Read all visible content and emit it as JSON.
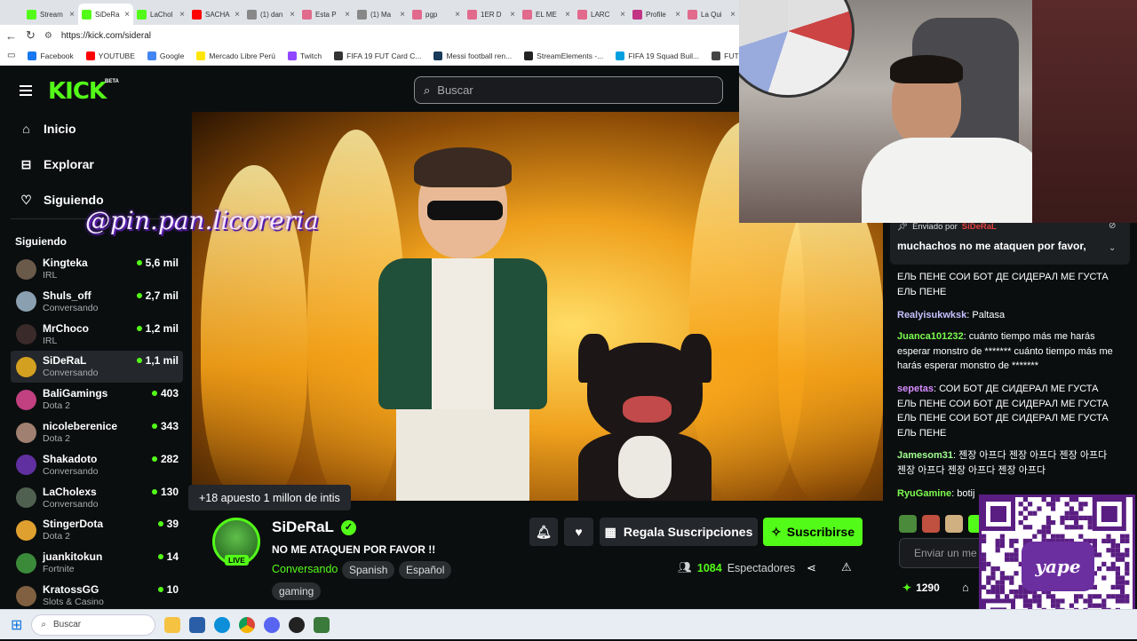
{
  "browser": {
    "tabs": [
      {
        "label": "Stream",
        "color": "#53fc18"
      },
      {
        "label": "SiDeRa",
        "color": "#53fc18"
      },
      {
        "label": "LaChol",
        "color": "#53fc18"
      },
      {
        "label": "SACHA",
        "color": "#ff0000"
      },
      {
        "label": "(1) dan",
        "color": "#888888"
      },
      {
        "label": "Esta P",
        "color": "#e26a8d"
      },
      {
        "label": "(1) Ma",
        "color": "#888888"
      },
      {
        "label": "pgp",
        "color": "#e26a8d"
      },
      {
        "label": "1ER D",
        "color": "#e26a8d"
      },
      {
        "label": "EL ME",
        "color": "#e26a8d"
      },
      {
        "label": "LARC",
        "color": "#e26a8d"
      },
      {
        "label": "Profile",
        "color": "#c13584"
      },
      {
        "label": "La Qui",
        "color": "#e26a8d"
      }
    ],
    "url": "https://kick.com/sideral",
    "bookmarks": [
      {
        "label": "Facebook",
        "color": "#1877f2"
      },
      {
        "label": "YOUTUBE",
        "color": "#ff0000"
      },
      {
        "label": "Google",
        "color": "#4285f4"
      },
      {
        "label": "Mercado Libre Perú",
        "color": "#ffe600"
      },
      {
        "label": "Twitch",
        "color": "#9146ff"
      },
      {
        "label": "FIFA 19 FUT Card C...",
        "color": "#333333"
      },
      {
        "label": "Messi football ren...",
        "color": "#1a3a5a"
      },
      {
        "label": "StreamElements -...",
        "color": "#222222"
      },
      {
        "label": "FIFA 19 Squad Buil...",
        "color": "#00a0e0"
      },
      {
        "label": "FUT Web App",
        "color": "#444444"
      }
    ]
  },
  "header": {
    "logo": "KICK",
    "beta": "BETA",
    "search_placeholder": "Buscar"
  },
  "nav": [
    {
      "label": "Inicio",
      "icon": "home-icon"
    },
    {
      "label": "Explorar",
      "icon": "compass-icon"
    },
    {
      "label": "Siguiendo",
      "icon": "heart-icon"
    }
  ],
  "following": {
    "title": "Siguiendo",
    "channels": [
      {
        "name": "Kingteka",
        "category": "IRL",
        "viewers": "5,6 mil",
        "color": "#6a5a4a"
      },
      {
        "name": "Shuls_off",
        "category": "Conversando",
        "viewers": "2,7 mil",
        "color": "#8aa0b0"
      },
      {
        "name": "MrChoco",
        "category": "IRL",
        "viewers": "1,2 mil",
        "color": "#3a2a2a"
      },
      {
        "name": "SiDeRaL",
        "category": "Conversando",
        "viewers": "1,1 mil",
        "color": "#d4a020"
      },
      {
        "name": "BaliGamings",
        "category": "Dota 2",
        "viewers": "403",
        "color": "#c04080"
      },
      {
        "name": "nicoleberenice",
        "category": "Dota 2",
        "viewers": "343",
        "color": "#a08070"
      },
      {
        "name": "Shakadoto",
        "category": "Conversando",
        "viewers": "282",
        "color": "#6030a0"
      },
      {
        "name": "LaCholexs",
        "category": "Conversando",
        "viewers": "130",
        "color": "#506050"
      },
      {
        "name": "StingerDota",
        "category": "Dota 2",
        "viewers": "39",
        "color": "#e0a030"
      },
      {
        "name": "juankitokun",
        "category": "Fortnite",
        "viewers": "14",
        "color": "#3a8a3a"
      },
      {
        "name": "KratossGG",
        "category": "Slots & Casino",
        "viewers": "10",
        "color": "#806040"
      }
    ]
  },
  "overlay": {
    "watermark": "@pin.pan.licoreria",
    "tooltip": "+18 apuesto 1 millon de intis"
  },
  "stream": {
    "streamer": "SiDeRaL",
    "live": "LIVE",
    "title": "NO ME ATAQUEN POR FAVOR !!",
    "category": "Conversando",
    "tags": [
      "Spanish",
      "Español",
      "gaming"
    ],
    "gift_label": "Regala Suscripciones",
    "subscribe_label": "Suscribirse",
    "viewers_count": "1084",
    "viewers_label": "Espectadores"
  },
  "chat": {
    "pinned_by": "Enviado por",
    "pinned_user": "SiDeRaL",
    "pinned_message": "muchachos no me ataquen por favor,",
    "messages": [
      {
        "user": "",
        "text": "ЕЛЬ ПЕНЕ СОИ БОТ ДЕ СИДЕРАЛ МЕ ГУСТА ЕЛЬ ПЕНЕ",
        "color": "#ffffff"
      },
      {
        "user": "Realyisukwksk",
        "text": "Paltasa",
        "color": "#c8c0ff"
      },
      {
        "user": "Juanca101232",
        "text": "cuánto tiempo más me harás esperar monstro de ******* cuánto tiempo más me harás esperar monstro de *******",
        "color": "#7dfc4f"
      },
      {
        "user": "sepetas",
        "text": "СОИ БОТ ДЕ СИДЕРАЛ МЕ ГУСТА ЕЛЬ ПЕНЕ СОИ БОТ ДЕ СИДЕРАЛ МЕ ГУСТА ЕЛЬ ПЕНЕ СОИ БОТ ДЕ СИДЕРАЛ МЕ ГУСТА ЕЛЬ ПЕНЕ",
        "color": "#d68cff"
      },
      {
        "user": "Jamesom31",
        "text": "젠장 아프다 젠장 아프다 젠장 아프다 젠장 아프다 젠장 아프다 젠장 아프다",
        "color": "#a0ff90"
      },
      {
        "user": "RyuGamine",
        "text": "botij",
        "color": "#7dfc4f"
      }
    ],
    "input_placeholder": "Enviar un me",
    "points": "1290"
  },
  "qr": {
    "brand": "yape"
  },
  "taskbar": {
    "search_placeholder": "Buscar"
  }
}
